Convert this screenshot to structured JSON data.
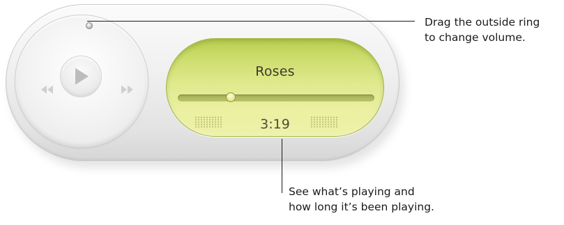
{
  "player": {
    "song_title": "Roses",
    "time": "3:19",
    "progress_fraction": 0.27,
    "controls": {
      "rewind": "rewind-icon",
      "play": "play-icon",
      "fast_forward": "fast-forward-icon"
    }
  },
  "callouts": {
    "volume": {
      "line1": "Drag the outside ring",
      "line2": "to change volume."
    },
    "display": {
      "line1": "See what’s playing and",
      "line2": "how long it’s been playing."
    }
  },
  "colors": {
    "display_lcd": "#dfe98c",
    "display_border": "#9fb43c",
    "widget_body": "#eeeeee",
    "text_dark": "#1a1a1a"
  }
}
